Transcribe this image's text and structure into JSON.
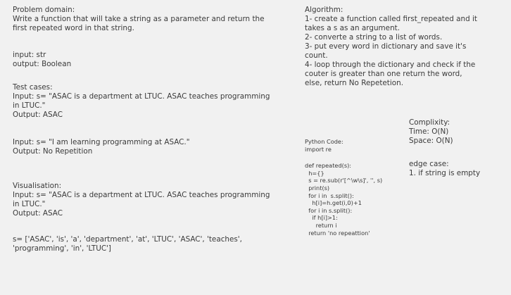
{
  "problem": {
    "heading": "Problem domain:",
    "lines": [
      "Write a function that will take a string as a parameter and return the",
      "first repeated word in that string."
    ]
  },
  "io": {
    "input": "input: str",
    "output": "output: Boolean"
  },
  "tests": {
    "heading": "Test cases:",
    "case1_lines": [
      "Input: s= \"ASAC is a department at LTUC. ASAC teaches programming",
      "in LTUC.\""
    ],
    "case1_output": "Output: ASAC",
    "case2_input": "Input: s= \"I am learning programming at ASAC.\"",
    "case2_output": "Output: No Repetition"
  },
  "visualisation": {
    "heading": "Visualisation:",
    "input_lines": [
      "Input: s= \"ASAC is a department at LTUC. ASAC teaches programming",
      "in LTUC.\""
    ],
    "output": "Output: ASAC",
    "list_lines": [
      "s= ['ASAC', 'is', 'a', 'department', 'at', 'LTUC', 'ASAC', 'teaches',",
      "'programming', 'in', 'LTUC']"
    ]
  },
  "algorithm": {
    "heading": "Algorithm:",
    "lines": [
      "1- create a function called first_repeated and it",
      "takes a s as an argument.",
      "2- converte a string to a list of words.",
      "3- put every word in dictionary and save it's",
      "count.",
      "4- loop through the dictionary and check if the",
      "couter is greater than one return the word,",
      "else, return No Repetetion."
    ]
  },
  "complexity": {
    "heading": "Complixity:",
    "time": "Time: O(N)",
    "space": "Space: O(N)"
  },
  "edge": {
    "heading": "edge case:",
    "item": "1. if string is empty"
  },
  "code": {
    "heading": "Python Code:",
    "import": "import re",
    "lines": [
      "def repeated(s):",
      "  h={}",
      "  s = re.sub(r'[^\\w\\s]', '', s)",
      "  print(s)",
      "  for i in  s.split():",
      "    h[i]=h.get(i,0)+1",
      "  for i in s.split():",
      "    if h[i]>1:",
      "      return i",
      "  return 'no repeattion'"
    ]
  }
}
